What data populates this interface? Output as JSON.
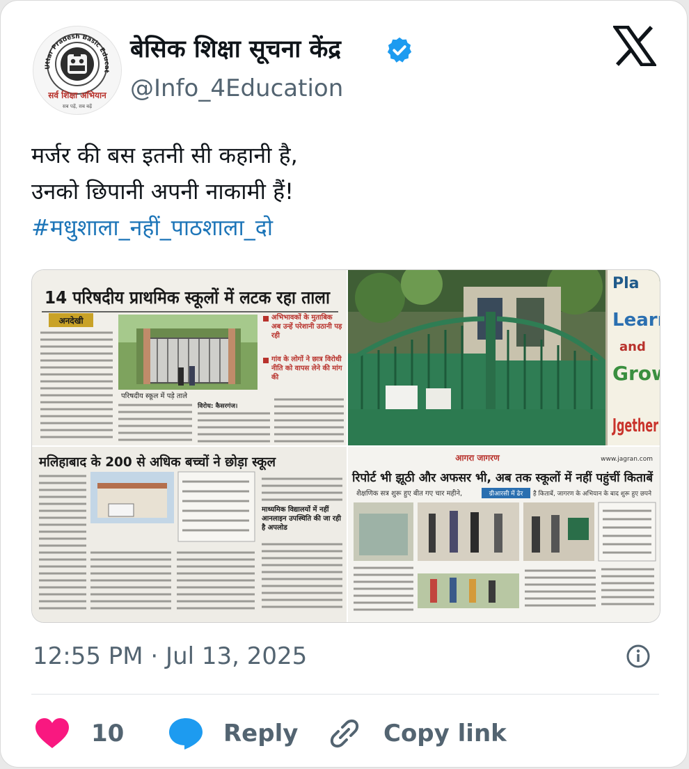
{
  "account": {
    "display_name": "बेसिक शिक्षा सूचना केंद्र",
    "handle": "@Info_4Education",
    "avatar_ring_text": "Uttar Pradesh Basic Education Board",
    "avatar_caption": "सर्व शिक्षा अभियान",
    "avatar_motto": "सब पढ़ें, सब बढ़ें",
    "verified_color": "#1d9bf0"
  },
  "tweet": {
    "line1": "मर्जर की बस इतनी सी कहानी है,",
    "line2": "उनको छिपानी अपनी नाकामी हैं!",
    "hashtag": "#मधुशाला_नहीं_पाठशाला_दो",
    "timestamp": "12:55 PM · Jul 13, 2025"
  },
  "media": {
    "clip1": {
      "headline": "14 परिषदीय प्राथमिक स्कूलों में लटक रहा ताला",
      "tag": "अनदेखी",
      "photo_caption": "परिषदीय स्कूल में पड़े ताले",
      "bullet1": "अभिभावकों के मुताबिक अब उन्हें परेशानी उठानी पड़ रही",
      "bullet2": "गांव के लोगों ने छात्र विरोधी नीति को वापस लेने की मांग की",
      "para_lead": "बाराबंकी। इलाके के ऐसे बेसिक परिषद के परिषदीय विद्यालय जिसमें 50 से कम बच्चे पढ़ाई कर रहे थे।",
      "sub_heading": "विरोध: कैसरगंज।"
    },
    "clip2": {
      "headline": "मलिहाबाद के 200 से अधिक बच्चों ने छोड़ा स्कूल",
      "sub_heading": "माध्यमिक विद्यालयों में नहीं आनलाइन उपस्थिति की जा रही है अपलोड"
    },
    "clip3": {
      "masthead": "आगरा जागरण",
      "site": "www.jagran.com",
      "headline": "रिपोर्ट भी झूठी और अफसर भी, अब तक स्कूलों में नहीं पहुंचीं किताबें",
      "subline": "शैक्षणिक सत्र शुरू हुए बीत गए चार महीने,",
      "badge": "ग्रीआरसी में ढेर",
      "subline2": "है किताबें, जागरण के अभियान के बाद शुरू हुए छपने"
    },
    "wall_words": [
      "Pla",
      "Learn",
      "and",
      "Grow",
      "Jgether"
    ]
  },
  "actions": {
    "like_count": "10",
    "reply_label": "Reply",
    "copy_label": "Copy link"
  },
  "colors": {
    "like": "#f91880",
    "reply": "#1d9bf0",
    "hashtag": "#1d75b8",
    "text": "#0f1419",
    "muted": "#536471"
  }
}
